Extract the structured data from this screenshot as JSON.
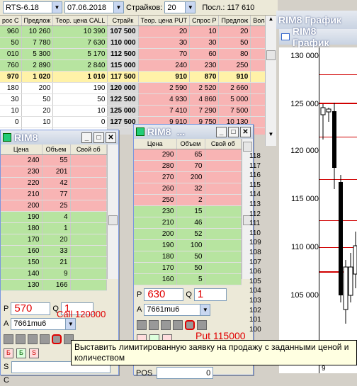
{
  "toolbar": {
    "contract": "RTS-6.18",
    "date": "07.06.2018",
    "strikes_label": "Страйков:",
    "strikes_value": "20",
    "last_label": "Посл.: 117 610"
  },
  "board": {
    "headers": [
      "рос С",
      "Предлож",
      "Теор. цена CALL",
      "Страйк",
      "Теор. цена PUT",
      "Спрос P",
      "Предлож",
      "Волати"
    ],
    "rows": [
      {
        "c1": "960",
        "c2": "10 260",
        "c3": "10 390",
        "strike": "107 500",
        "p1": "20",
        "p2": "10",
        "p3": "20",
        "side": "itm"
      },
      {
        "c1": "50",
        "c2": "7 780",
        "c3": "7 630",
        "strike": "110 000",
        "p1": "30",
        "p2": "30",
        "p3": "50",
        "side": "itm"
      },
      {
        "c1": "010",
        "c2": "5 300",
        "c3": "5 170",
        "strike": "112 500",
        "p1": "70",
        "p2": "60",
        "p3": "80",
        "side": "itm"
      },
      {
        "c1": "760",
        "c2": "2 890",
        "c3": "2 840",
        "strike": "115 000",
        "p1": "240",
        "p2": "230",
        "p3": "250",
        "side": "itm"
      },
      {
        "c1": "970",
        "c2": "1 020",
        "c3": "1 010",
        "strike": "117 500",
        "p1": "910",
        "p2": "870",
        "p3": "910",
        "side": "atm"
      },
      {
        "c1": "180",
        "c2": "200",
        "c3": "190",
        "strike": "120 000",
        "p1": "2 590",
        "p2": "2 520",
        "p3": "2 660",
        "side": "otm"
      },
      {
        "c1": "30",
        "c2": "50",
        "c3": "50",
        "strike": "122 500",
        "p1": "4 930",
        "p2": "4 860",
        "p3": "5 000",
        "side": "otm"
      },
      {
        "c1": "10",
        "c2": "20",
        "c3": "10",
        "strike": "125 000",
        "p1": "7 410",
        "p2": "7 290",
        "p3": "7 500",
        "side": "otm"
      },
      {
        "c1": "0",
        "c2": "10",
        "c3": "0",
        "strike": "127 500",
        "p1": "9 910",
        "p2": "9 750",
        "p3": "10 130",
        "side": "otm"
      },
      {
        "c1": "",
        "c2": "",
        "c3": "",
        "strike": "",
        "p1": "",
        "p2": "",
        "p3": "",
        "side": "otm"
      }
    ]
  },
  "chart1": {
    "title": "RIM8 График",
    "prices": [
      "130 000",
      "125 000",
      "120 000",
      "115 000",
      "110 000",
      "105 000"
    ],
    "xlabel": "9"
  },
  "chart2": {
    "title": "RIM8 График"
  },
  "left_window": {
    "title": "RIM8",
    "headers": [
      "Цена",
      "Объем",
      "Свой об"
    ],
    "asks": [
      [
        "240",
        "55"
      ],
      [
        "230",
        "201"
      ],
      [
        "220",
        "42"
      ],
      [
        "210",
        "77"
      ],
      [
        "200",
        "25"
      ]
    ],
    "bids": [
      [
        "190",
        "4"
      ],
      [
        "180",
        "1"
      ],
      [
        "170",
        "20"
      ],
      [
        "160",
        "33"
      ],
      [
        "150",
        "21"
      ],
      [
        "140",
        "9"
      ],
      [
        "130",
        "166"
      ]
    ],
    "p_label": "P",
    "p_value": "570",
    "q_label": "Q",
    "q_value": "1",
    "a_label": "A",
    "account": "7661mu6",
    "annotation": "Call 120000",
    "side_letters": [
      "Б",
      "Б",
      "S"
    ]
  },
  "right_window": {
    "title": "RIM8",
    "title_ellipsis": "...",
    "headers": [
      "Цена",
      "Объем",
      "Свой об"
    ],
    "asks": [
      [
        "290",
        "65"
      ],
      [
        "280",
        "70"
      ],
      [
        "270",
        "200"
      ],
      [
        "260",
        "32"
      ],
      [
        "250",
        "2"
      ]
    ],
    "bids": [
      [
        "230",
        "15"
      ],
      [
        "210",
        "46"
      ],
      [
        "200",
        "52"
      ],
      [
        "190",
        "100"
      ],
      [
        "180",
        "50"
      ],
      [
        "170",
        "50"
      ],
      [
        "160",
        "5"
      ]
    ],
    "p_label": "P",
    "p_value": "630",
    "q_label": "Q",
    "q_value": "1",
    "a_label": "A",
    "account": "7661mu6",
    "annotation": "Put 115000",
    "row_labels": [
      "118",
      "117",
      "116",
      "115",
      "114",
      "113",
      "112",
      "111",
      "110",
      "109",
      "108",
      "107",
      "106",
      "105",
      "104",
      "103",
      "102",
      "101",
      "100"
    ]
  },
  "tooltip": "Выставить лимитированную заявку на продажу с заданными ценой и количеством",
  "bottom": {
    "s_label": "S",
    "c_label": "C",
    "pos_label": "POS",
    "pos_value": "0"
  }
}
